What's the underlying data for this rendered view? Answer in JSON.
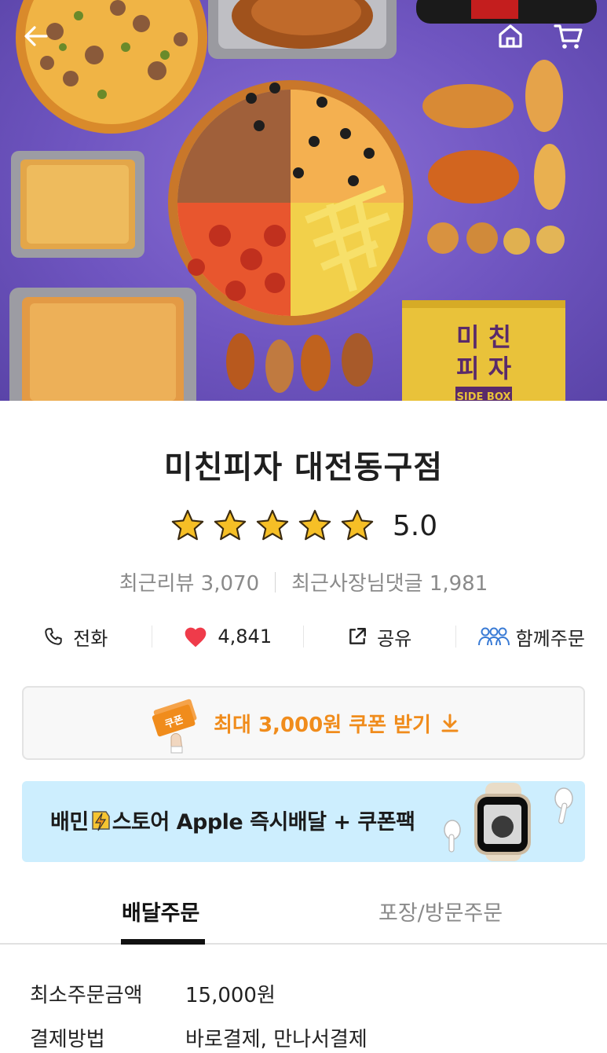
{
  "header": {
    "back_icon": "arrow-left-icon",
    "home_icon": "home-icon",
    "cart_icon": "cart-icon"
  },
  "hero": {
    "box_line1": "미 친",
    "box_line2": "피 자",
    "box_tag": "SIDE BOX"
  },
  "store": {
    "name": "미친피자 대전동구점",
    "rating": "5.0",
    "rating_stars": 5,
    "recent_reviews": "최근리뷰 3,070",
    "owner_replies": "최근사장님댓글 1,981"
  },
  "actions": [
    {
      "icon": "phone-icon",
      "label": "전화"
    },
    {
      "icon": "heart-icon",
      "label": "4,841"
    },
    {
      "icon": "share-icon",
      "label": "공유"
    },
    {
      "icon": "group-order-icon",
      "label": "함께주문"
    }
  ],
  "coupon": {
    "label": "최대 3,000원 쿠폰 받기",
    "ticket_text": "쿠폰"
  },
  "banner": {
    "text_pre": "배민",
    "text_post": "스토어 Apple 즉시배달 + 쿠폰팩"
  },
  "tabs": [
    {
      "label": "배달주문"
    },
    {
      "label": "포장/방문주문"
    }
  ],
  "info": [
    {
      "label": "최소주문금액",
      "value": "15,000원"
    },
    {
      "label": "결제방법",
      "value": "바로결제, 만나서결제"
    }
  ],
  "colors": {
    "accent": "#f08c1c",
    "heart": "#ef3b4a",
    "star": "#f6bf26",
    "banner_bg": "#cdeefe",
    "hero_bg": "#6f55c0"
  }
}
